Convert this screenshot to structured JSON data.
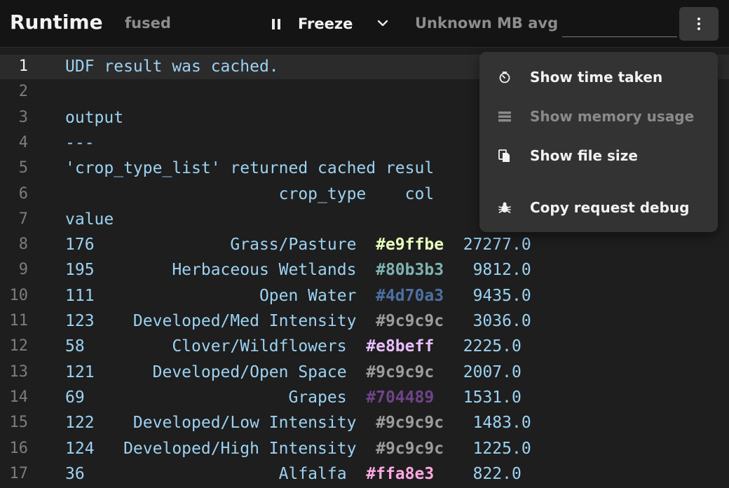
{
  "header": {
    "title": "Runtime",
    "subtitle": "fused",
    "freeze_label": "Freeze",
    "memory_label": "Unknown MB avg",
    "memory_value": ""
  },
  "editor": {
    "active_line": 1,
    "lines": [
      {
        "n": "1",
        "text": "UDF result was cached."
      },
      {
        "n": "2",
        "text": ""
      },
      {
        "n": "3",
        "text": "output"
      },
      {
        "n": "4",
        "text": "---"
      },
      {
        "n": "5",
        "text": "'crop_type_list' returned cached resul"
      },
      {
        "n": "6",
        "text": "                      crop_type    col"
      },
      {
        "n": "7",
        "text": "value"
      },
      {
        "n": "8",
        "prefix": "176              Grass/Pasture  ",
        "color_code": "#e9ffbe",
        "color": "#e9ffbe",
        "suffix": "  27277.0"
      },
      {
        "n": "9",
        "prefix": "195        Herbaceous Wetlands  ",
        "color_code": "#80b3b3",
        "color": "#80b3b3",
        "suffix": "   9812.0"
      },
      {
        "n": "10",
        "prefix": "111                 Open Water  ",
        "color_code": "#4d70a3",
        "color": "#4d70a3",
        "suffix": "   9435.0"
      },
      {
        "n": "11",
        "prefix": "123    Developed/Med Intensity  ",
        "color_code": "#9c9c9c",
        "color": "#9c9c9c",
        "suffix": "   3036.0"
      },
      {
        "n": "12",
        "prefix": "58         Clover/Wildflowers  ",
        "color_code": "#e8beff",
        "color": "#e8beff",
        "suffix": "   2225.0"
      },
      {
        "n": "13",
        "prefix": "121      Developed/Open Space  ",
        "color_code": "#9c9c9c",
        "color": "#9c9c9c",
        "suffix": "   2007.0"
      },
      {
        "n": "14",
        "prefix": "69                     Grapes  ",
        "color_code": "#704489",
        "color": "#704489",
        "suffix": "   1531.0"
      },
      {
        "n": "15",
        "prefix": "122    Developed/Low Intensity  ",
        "color_code": "#9c9c9c",
        "color": "#9c9c9c",
        "suffix": "   1483.0"
      },
      {
        "n": "16",
        "prefix": "124   Developed/High Intensity  ",
        "color_code": "#9c9c9c",
        "color": "#9c9c9c",
        "suffix": "   1225.0"
      },
      {
        "n": "17",
        "prefix": "36                    Alfalfa  ",
        "color_code": "#ffa8e3",
        "color": "#ffa8e3",
        "suffix": "    822.0"
      }
    ]
  },
  "menu": {
    "items": [
      {
        "label": "Show time taken",
        "icon": "timer-icon",
        "enabled": true
      },
      {
        "label": "Show memory usage",
        "icon": "memory-icon",
        "enabled": false
      },
      {
        "label": "Show file size",
        "icon": "file-copy-icon",
        "enabled": true
      },
      {
        "label": "Copy request debug",
        "icon": "bug-icon",
        "enabled": true
      }
    ]
  },
  "colors": {
    "background": "#1e1e1e",
    "topbar": "#141414",
    "code_text": "#9cd2f2",
    "menu_bg": "#333333"
  }
}
